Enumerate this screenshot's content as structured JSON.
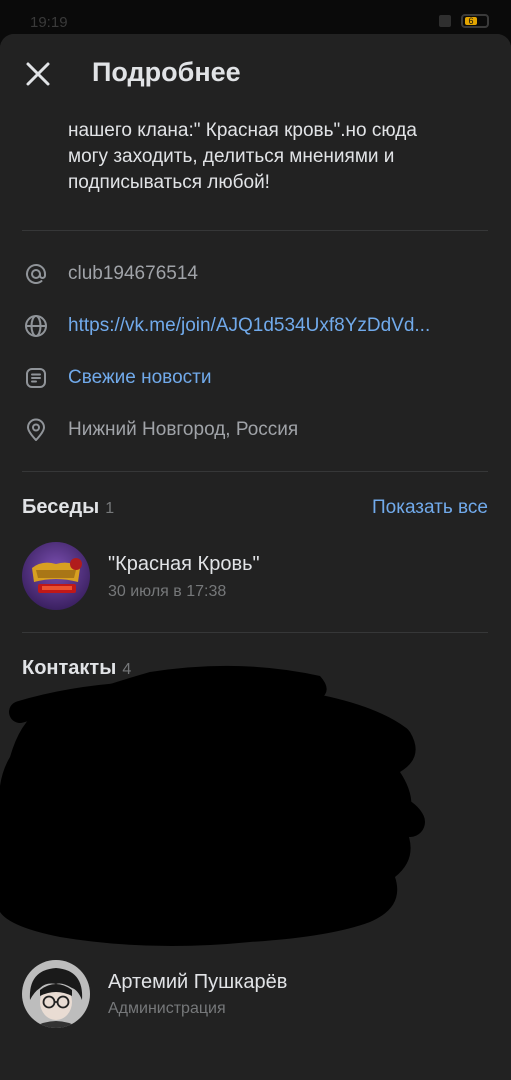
{
  "status_bar": {
    "time": "19:19",
    "battery": "6"
  },
  "header": {
    "title": "Подробнее"
  },
  "description": {
    "partial_line": "...",
    "lines": [
      "нашего клана:\" Красная кровь\".но сюда",
      "могу заходить, делиться мнениями и",
      "подписываться любой!"
    ]
  },
  "info": {
    "screen_name": "club194676514",
    "link": "https://vk.me/join/AJQ1d534Uxf8YzDdVd...",
    "news": "Свежие новости",
    "location": "Нижний Новгород, Россия"
  },
  "chats": {
    "title": "Беседы",
    "count": "1",
    "show_all": "Показать все",
    "items": [
      {
        "name": "\"Красная Кровь\"",
        "date": "30 июля в 17:38"
      }
    ]
  },
  "contacts": {
    "title": "Контакты",
    "count": "4",
    "items": [
      {
        "name": "Артемий Пушкарёв",
        "role": "Администрация"
      }
    ]
  },
  "colors": {
    "accent": "#71aaeb",
    "background": "#222222",
    "divider": "#363738"
  }
}
